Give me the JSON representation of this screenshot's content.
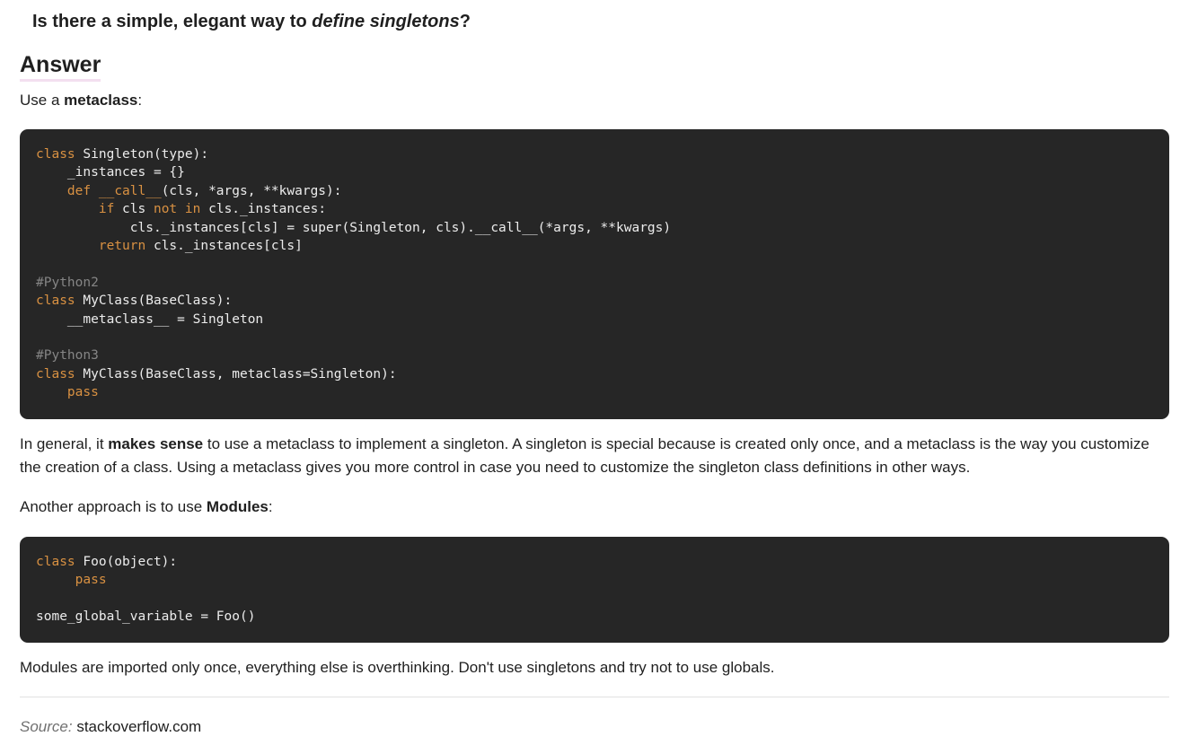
{
  "question": {
    "prefix": "Is there a simple, elegant way to ",
    "emphasis": "define singletons",
    "suffix": "?"
  },
  "answer_heading": "Answer",
  "intro": {
    "before": "Use a ",
    "bold": "metaclass",
    "after": ":"
  },
  "code_block_1": [
    [
      {
        "t": "class",
        "c": "kw"
      },
      {
        "t": " Singleton(type):"
      }
    ],
    [
      {
        "t": "    _instances = {}"
      }
    ],
    [
      {
        "t": "    "
      },
      {
        "t": "def",
        "c": "kw"
      },
      {
        "t": " "
      },
      {
        "t": "__call__",
        "c": "kw"
      },
      {
        "t": "(cls, *args, **kwargs):"
      }
    ],
    [
      {
        "t": "        "
      },
      {
        "t": "if",
        "c": "kw"
      },
      {
        "t": " cls "
      },
      {
        "t": "not",
        "c": "kw"
      },
      {
        "t": " "
      },
      {
        "t": "in",
        "c": "kw"
      },
      {
        "t": " cls._instances:"
      }
    ],
    [
      {
        "t": "            cls._instances[cls] = super(Singleton, cls).__call__(*args, **kwargs)"
      }
    ],
    [
      {
        "t": "        "
      },
      {
        "t": "return",
        "c": "kw"
      },
      {
        "t": " cls._instances[cls]"
      }
    ],
    [
      {
        "t": ""
      }
    ],
    [
      {
        "t": "#Python2",
        "c": "cm"
      }
    ],
    [
      {
        "t": "class",
        "c": "kw"
      },
      {
        "t": " MyClass(BaseClass):"
      }
    ],
    [
      {
        "t": "    __metaclass__ = Singleton"
      }
    ],
    [
      {
        "t": ""
      }
    ],
    [
      {
        "t": "#Python3",
        "c": "cm"
      }
    ],
    [
      {
        "t": "class",
        "c": "kw"
      },
      {
        "t": " MyClass(BaseClass, metaclass=Singleton):"
      }
    ],
    [
      {
        "t": "    "
      },
      {
        "t": "pass",
        "c": "kw"
      }
    ]
  ],
  "general": {
    "before": "In general, it ",
    "bold": "makes sense",
    "after": " to use a metaclass to implement a singleton. A singleton is special because is created only once, and a metaclass is the way you customize the creation of a class. Using a metaclass gives you more control in case you need to customize the singleton class definitions in other ways."
  },
  "another": {
    "before": "Another approach is to use ",
    "bold": "Modules",
    "after": ":"
  },
  "code_block_2": [
    [
      {
        "t": "class",
        "c": "kw"
      },
      {
        "t": " Foo(object):"
      }
    ],
    [
      {
        "t": "     "
      },
      {
        "t": "pass",
        "c": "kw"
      }
    ],
    [
      {
        "t": ""
      }
    ],
    [
      {
        "t": "some_global_variable = Foo()"
      }
    ]
  ],
  "modules_note": "Modules are imported only once, everything else is overthinking. Don't use singletons and try not to use globals.",
  "source": {
    "label": "Source:",
    "link": "stackoverflow.com"
  },
  "colors": {
    "code_background": "#262626",
    "keyword": "#d99142",
    "comment": "#858585"
  }
}
